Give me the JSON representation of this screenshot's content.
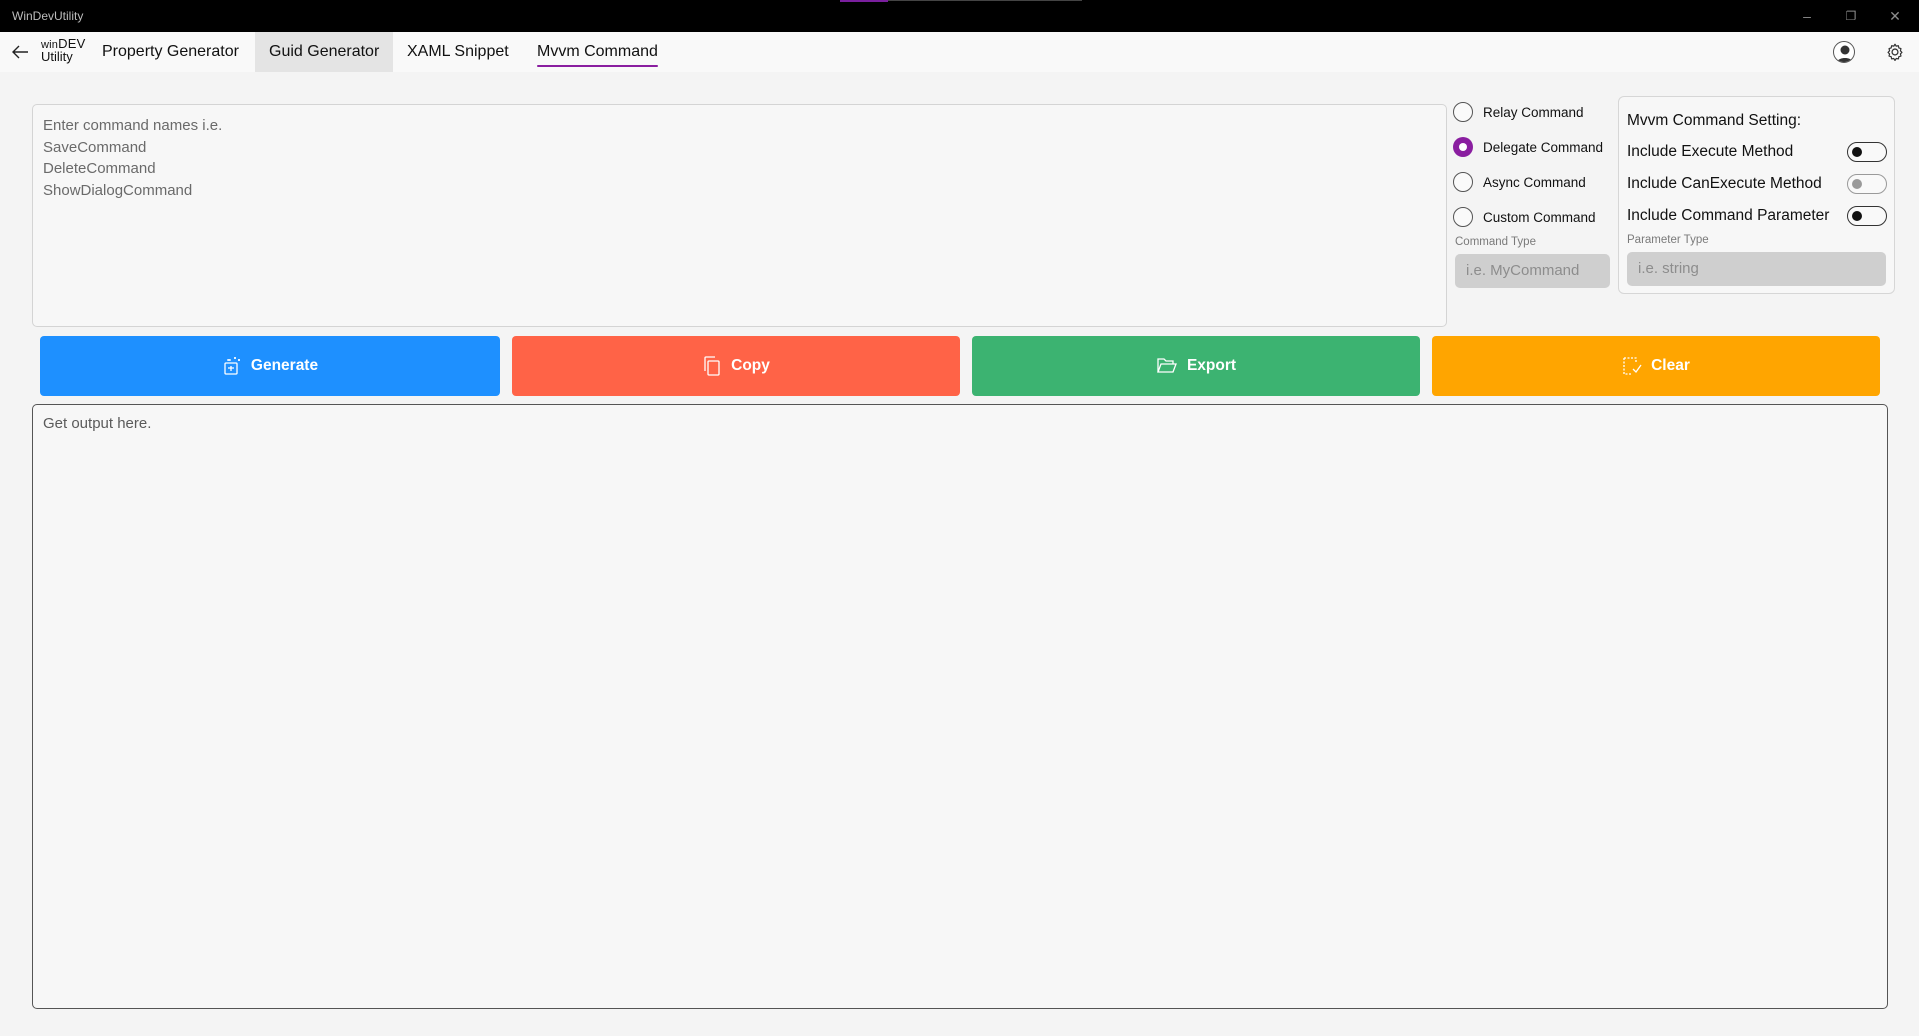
{
  "window": {
    "title": "WinDevUtility",
    "controls": {
      "minimize": "–",
      "restore": "❐",
      "close": "✕"
    }
  },
  "nav": {
    "logo": {
      "top_small": "win",
      "top_big": "DEV",
      "bottom": "Utility"
    },
    "tabs": [
      {
        "label": "Property Generator"
      },
      {
        "label": "Guid Generator"
      },
      {
        "label": "XAML Snippet"
      },
      {
        "label": "Mvvm Command"
      }
    ],
    "active_tab": "Mvvm Command",
    "accent_color": "#8a1ea0"
  },
  "input": {
    "placeholder_lines": [
      "Enter command names i.e.",
      "SaveCommand",
      "DeleteCommand",
      "ShowDialogCommand"
    ]
  },
  "command_options": {
    "options": [
      {
        "label": "Relay Command",
        "checked": false
      },
      {
        "label": "Delegate Command",
        "checked": true
      },
      {
        "label": "Async Command",
        "checked": false
      },
      {
        "label": "Custom Command",
        "checked": false
      }
    ],
    "command_type_label": "Command Type",
    "command_type_placeholder": "i.e. MyCommand"
  },
  "settings": {
    "heading": "Mvvm Command Setting:",
    "toggles": [
      {
        "label": "Include Execute Method",
        "on": false
      },
      {
        "label": "Include CanExecute Method",
        "on": false,
        "disabled": true
      },
      {
        "label": "Include Command Parameter",
        "on": false
      }
    ],
    "parameter_type_label": "Parameter Type",
    "parameter_type_placeholder": "i.e. string"
  },
  "actions": {
    "generate": {
      "label": "Generate",
      "color": "#1e90ff",
      "icon": "magic-wand-icon"
    },
    "copy": {
      "label": "Copy",
      "color": "#ff6347",
      "icon": "copy-icon"
    },
    "export": {
      "label": "Export",
      "color": "#3cb371",
      "icon": "folder-open-icon"
    },
    "clear": {
      "label": "Clear",
      "color": "#ffa500",
      "icon": "clear-icon"
    }
  },
  "output": {
    "placeholder": "Get output here."
  }
}
